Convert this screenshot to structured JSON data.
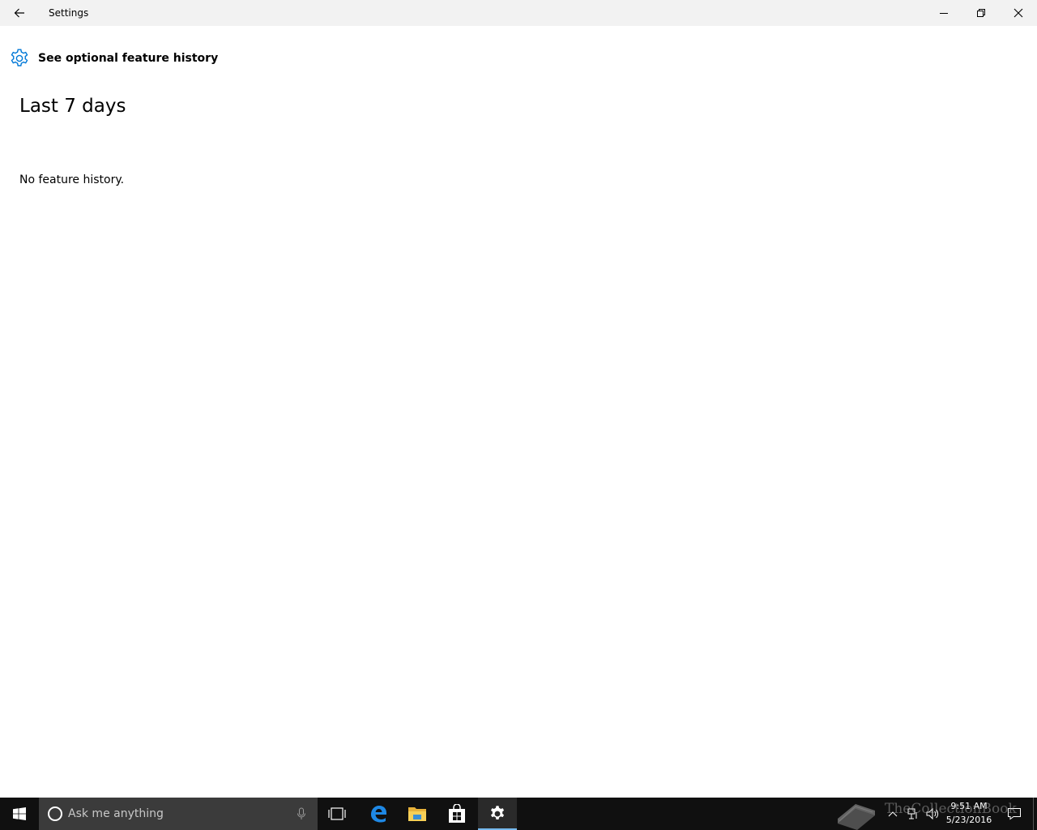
{
  "window": {
    "title": "Settings",
    "controls": [
      "minimize",
      "restore",
      "close"
    ]
  },
  "page": {
    "header_icon": "gear-icon",
    "title": "See optional feature history",
    "section_title": "Last 7 days",
    "empty_message": "No feature history."
  },
  "taskbar": {
    "search_placeholder": "Ask me anything",
    "apps": [
      "task-view-icon",
      "edge-icon",
      "file-explorer-icon",
      "store-icon",
      "settings-icon"
    ],
    "active_app": "settings-icon",
    "clock_time": "9:51 AM",
    "clock_date": "5/23/2016"
  },
  "watermark": {
    "text": "TheCollectionBook"
  },
  "colors": {
    "accent": "#0078d7",
    "titlebar_bg": "#f2f2f2",
    "taskbar_bg": "#101010",
    "search_bg": "#3b3b3b"
  }
}
